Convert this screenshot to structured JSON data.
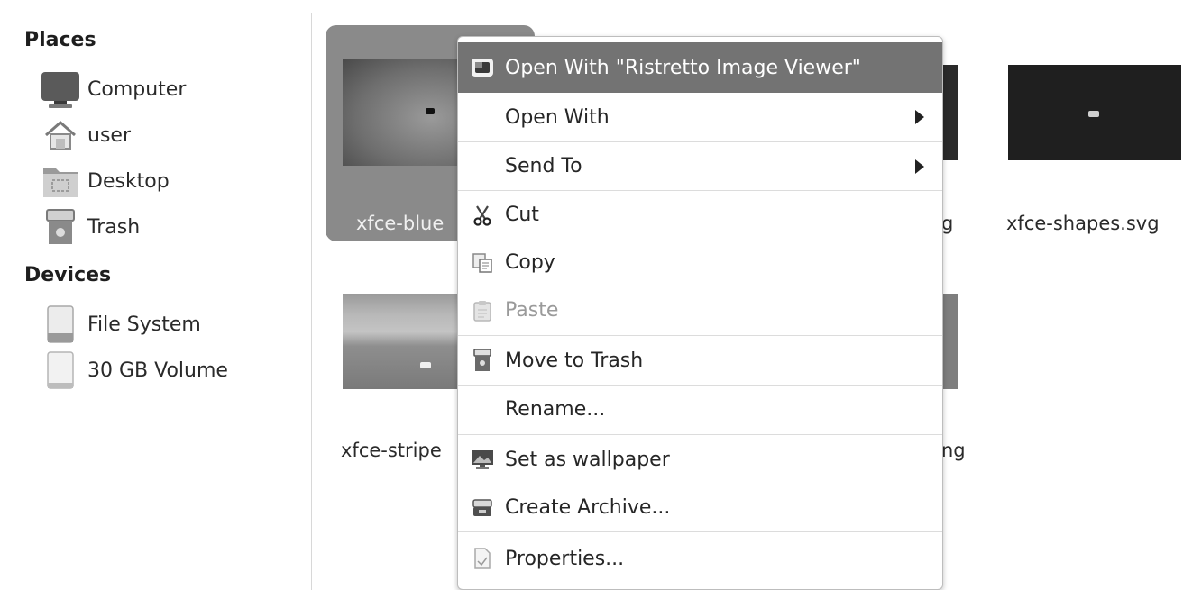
{
  "sidebar": {
    "places_heading": "Places",
    "places": [
      {
        "label": "Computer",
        "icon": "computer-icon"
      },
      {
        "label": "user",
        "icon": "home-folder-icon"
      },
      {
        "label": "Desktop",
        "icon": "desktop-folder-icon"
      },
      {
        "label": "Trash",
        "icon": "trash-icon"
      }
    ],
    "devices_heading": "Devices",
    "devices": [
      {
        "label": "File System",
        "icon": "drive-icon"
      },
      {
        "label": "30 GB Volume",
        "icon": "drive-icon"
      }
    ]
  },
  "files": [
    {
      "label": "xfce-blue",
      "selected": true
    },
    {
      "label": "g"
    },
    {
      "label": "xfce-shapes.svg"
    },
    {
      "label": "xfce-stripe"
    },
    {
      "label": "ng"
    }
  ],
  "context_menu": {
    "items": [
      {
        "label": "Open With \"Ristretto Image Viewer\"",
        "icon": "image-viewer-icon",
        "highlighted": true
      },
      {
        "label": "Open With",
        "submenu": true
      },
      {
        "label": "Send To",
        "submenu": true
      },
      {
        "label": "Cut",
        "icon": "scissors-icon"
      },
      {
        "label": "Copy",
        "icon": "copy-icon"
      },
      {
        "label": "Paste",
        "icon": "paste-icon",
        "disabled": true
      },
      {
        "label": "Move to Trash",
        "icon": "trash-icon"
      },
      {
        "label": "Rename..."
      },
      {
        "label": "Set as wallpaper",
        "icon": "wallpaper-icon"
      },
      {
        "label": "Create Archive...",
        "icon": "archive-icon"
      },
      {
        "label": "Properties...",
        "icon": "properties-icon"
      }
    ]
  },
  "colors": {
    "highlight": "#737373",
    "selected_tile": "#8a8a8a"
  }
}
